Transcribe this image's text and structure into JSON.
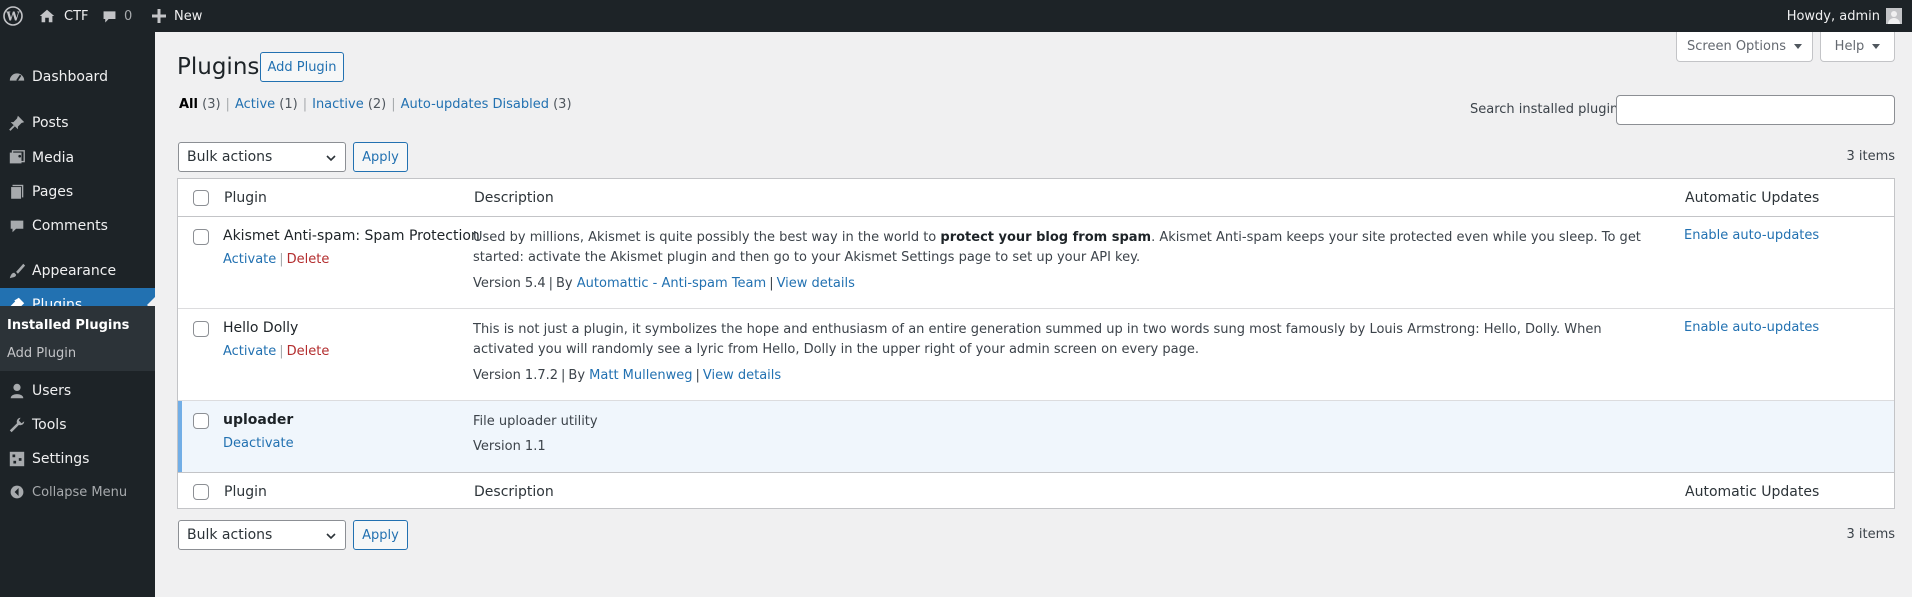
{
  "adminbar": {
    "site_name": "CTF",
    "comments_count": "0",
    "new_label": "New",
    "howdy": "Howdy, admin"
  },
  "sidebar": {
    "items": [
      {
        "label": "Dashboard",
        "icon": "dashboard-icon"
      },
      {
        "label": "Posts",
        "icon": "pin-icon"
      },
      {
        "label": "Media",
        "icon": "media-icon"
      },
      {
        "label": "Pages",
        "icon": "pages-icon"
      },
      {
        "label": "Comments",
        "icon": "comments-icon"
      },
      {
        "label": "Appearance",
        "icon": "paintbrush-icon"
      },
      {
        "label": "Plugins",
        "icon": "plugins-icon"
      },
      {
        "label": "Users",
        "icon": "users-icon"
      },
      {
        "label": "Tools",
        "icon": "wrench-icon"
      },
      {
        "label": "Settings",
        "icon": "settings-icon"
      }
    ],
    "submenu": [
      "Installed Plugins",
      "Add Plugin"
    ],
    "collapse_label": "Collapse Menu"
  },
  "header": {
    "title": "Plugins",
    "add_button": "Add Plugin",
    "screen_options": "Screen Options",
    "help": "Help"
  },
  "filters": [
    {
      "label": "All",
      "count": "(3)"
    },
    {
      "label": "Active",
      "count": "(1)"
    },
    {
      "label": "Inactive",
      "count": "(2)"
    },
    {
      "label": "Auto-updates Disabled",
      "count": "(3)"
    }
  ],
  "search": {
    "label": "Search installed plugins",
    "value": ""
  },
  "bulk": {
    "selected": "Bulk actions",
    "apply": "Apply",
    "items_count": "3 items"
  },
  "table": {
    "columns": [
      "Plugin",
      "Description",
      "Automatic Updates"
    ],
    "rows": [
      {
        "name": "Akismet Anti-spam: Spam Protection",
        "actions": [
          "Activate",
          "Delete"
        ],
        "desc_pre": "Used by millions, Akismet is quite possibly the best way in the world to ",
        "desc_bold": "protect your blog from spam",
        "desc_post": ". Akismet Anti-spam keeps your site protected even while you sleep. To get started: activate the Akismet plugin and then go to your Akismet Settings page to set up your API key.",
        "version": "Version 5.4",
        "by": "By",
        "author": "Automattic - Anti-spam Team",
        "details": "View details",
        "auto": "Enable auto-updates"
      },
      {
        "name": "Hello Dolly",
        "actions": [
          "Activate",
          "Delete"
        ],
        "desc": "This is not just a plugin, it symbolizes the hope and enthusiasm of an entire generation summed up in two words sung most famously by Louis Armstrong: Hello, Dolly. When activated you will randomly see a lyric from Hello, Dolly in the upper right of your admin screen on every page.",
        "version": "Version 1.7.2",
        "by": "By",
        "author": "Matt Mullenweg",
        "details": "View details",
        "auto": "Enable auto-updates"
      },
      {
        "name": "uploader",
        "actions": [
          "Deactivate"
        ],
        "desc": "File uploader utility",
        "version": "Version 1.1"
      }
    ]
  }
}
